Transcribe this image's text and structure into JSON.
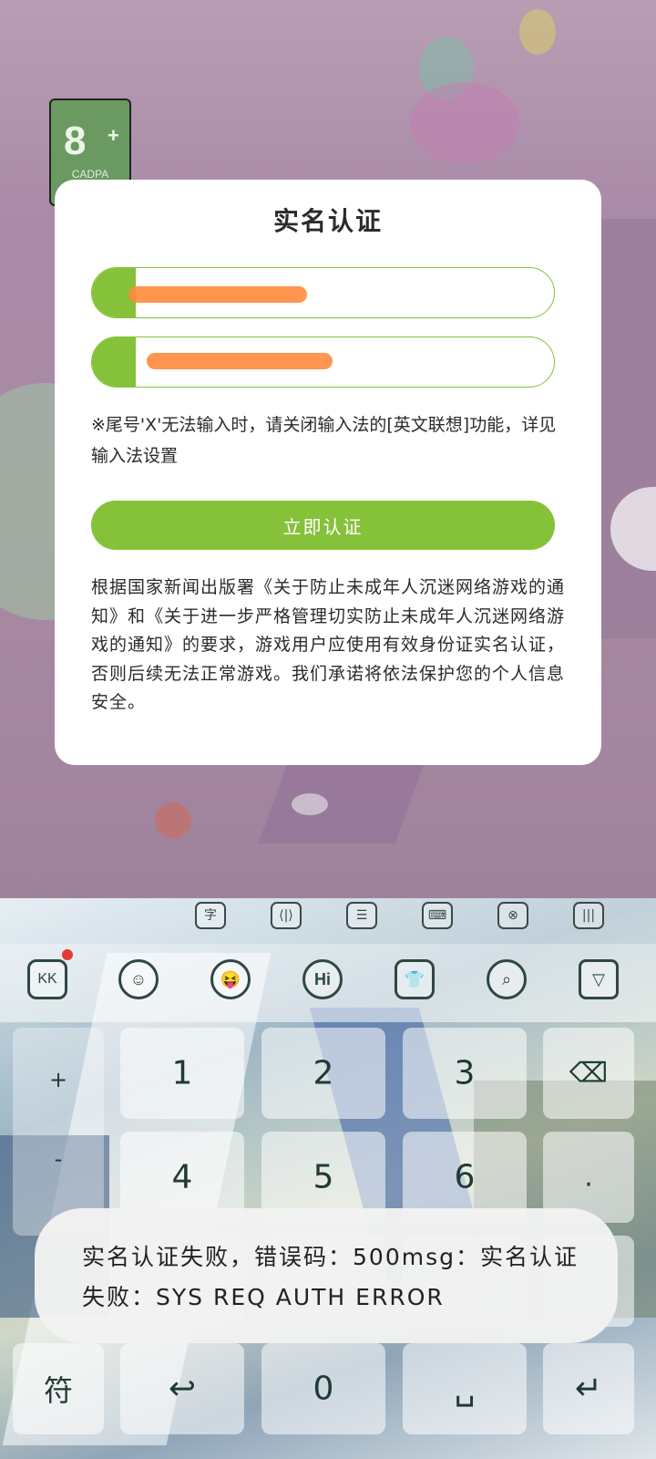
{
  "age_rating": {
    "number": "8",
    "plus": "+",
    "org": "CADPA"
  },
  "dialog": {
    "title": "实名认证",
    "hint": "※尾号'X'无法输入时，请关闭输入法的[英文联想]功能，详见输入法设置",
    "verify_button": "立即认证",
    "notice": "根据国家新闻出版署《关于防止未成年人沉迷网络游戏的通知》和《关于进一步严格管理切实防止未成年人沉迷网络游戏的通知》的要求，游戏用户应使用有效身份证实名认证，否则后续无法正常游戏。我们承诺将依法保护您的个人信息安全。"
  },
  "keyboard": {
    "top_icons": [
      "字",
      "⟨|⟩",
      "☰",
      "⌨",
      "⊗",
      "|||"
    ],
    "toolbar_icons": [
      "KK",
      "☺",
      "😝",
      "Hi",
      "👕",
      "⌕",
      "▽"
    ],
    "keys": {
      "plus": "+",
      "one": "1",
      "two": "2",
      "three": "3",
      "backspace": "⌫",
      "minus": "-",
      "four": "4",
      "five": "5",
      "six": "6",
      "dot": ".",
      "symbols": "符",
      "back": "↩",
      "zero": "0",
      "space": "␣",
      "enter": "↵"
    }
  },
  "toast": {
    "message": "实名认证失败，错误码：500msg：实名认证失败：SYS REQ AUTH ERROR"
  },
  "colors": {
    "accent_green": "#86c13a",
    "redact_orange": "#ff8a3c"
  }
}
